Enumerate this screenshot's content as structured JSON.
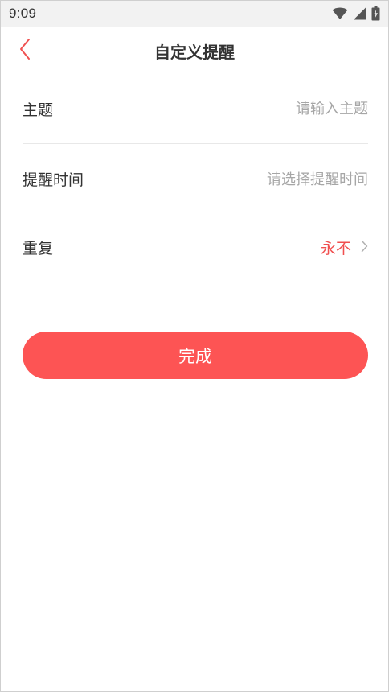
{
  "status_bar": {
    "time": "9:09",
    "icons": [
      "wifi-icon",
      "signal-icon",
      "battery-charging-icon"
    ]
  },
  "nav": {
    "back_icon": "chevron-left-icon",
    "title": "自定义提醒"
  },
  "form": {
    "subject": {
      "label": "主题",
      "placeholder": "请输入主题",
      "value": ""
    },
    "reminder_time": {
      "label": "提醒时间",
      "placeholder": "请选择提醒时间"
    },
    "repeat": {
      "label": "重复",
      "value": "永不",
      "icon": "chevron-right-icon"
    }
  },
  "actions": {
    "done_label": "完成"
  },
  "colors": {
    "accent": "#fd5454",
    "repeat_value": "#f05050",
    "placeholder": "#a6a6a6",
    "status_bar_bg": "#f2f2f2"
  }
}
